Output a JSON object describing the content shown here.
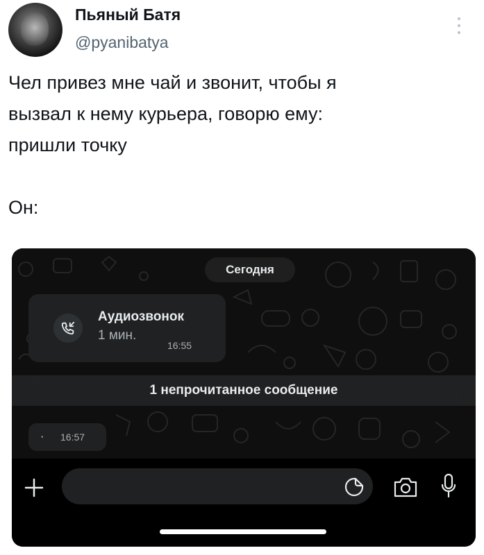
{
  "tweet": {
    "author_name": "Пьяный Батя",
    "author_handle": "@pyanibatya",
    "text_lines": [
      "Чел привез мне чай и звонит, чтобы я",
      "вызвал к нему курьера, говорю ему:",
      "пришли точку"
    ],
    "punchline": "Он:"
  },
  "chat": {
    "date_label": "Сегодня",
    "call": {
      "title": "Аудиозвонок",
      "duration": "1 мин.",
      "time": "16:55",
      "icon": "incoming-call-icon"
    },
    "unread_label": "1 непрочитанное сообщение",
    "message": {
      "text": "·",
      "time": "16:57"
    },
    "input": {
      "placeholder": ""
    },
    "icons": [
      "plus-icon",
      "sticker-icon",
      "camera-icon",
      "microphone-icon"
    ]
  },
  "colors": {
    "chat_background": "#0f0f0f",
    "bubble": "#1f2123",
    "text_light": "#e9edef",
    "text_muted": "#aab1b6",
    "handle_gray": "#536471"
  }
}
